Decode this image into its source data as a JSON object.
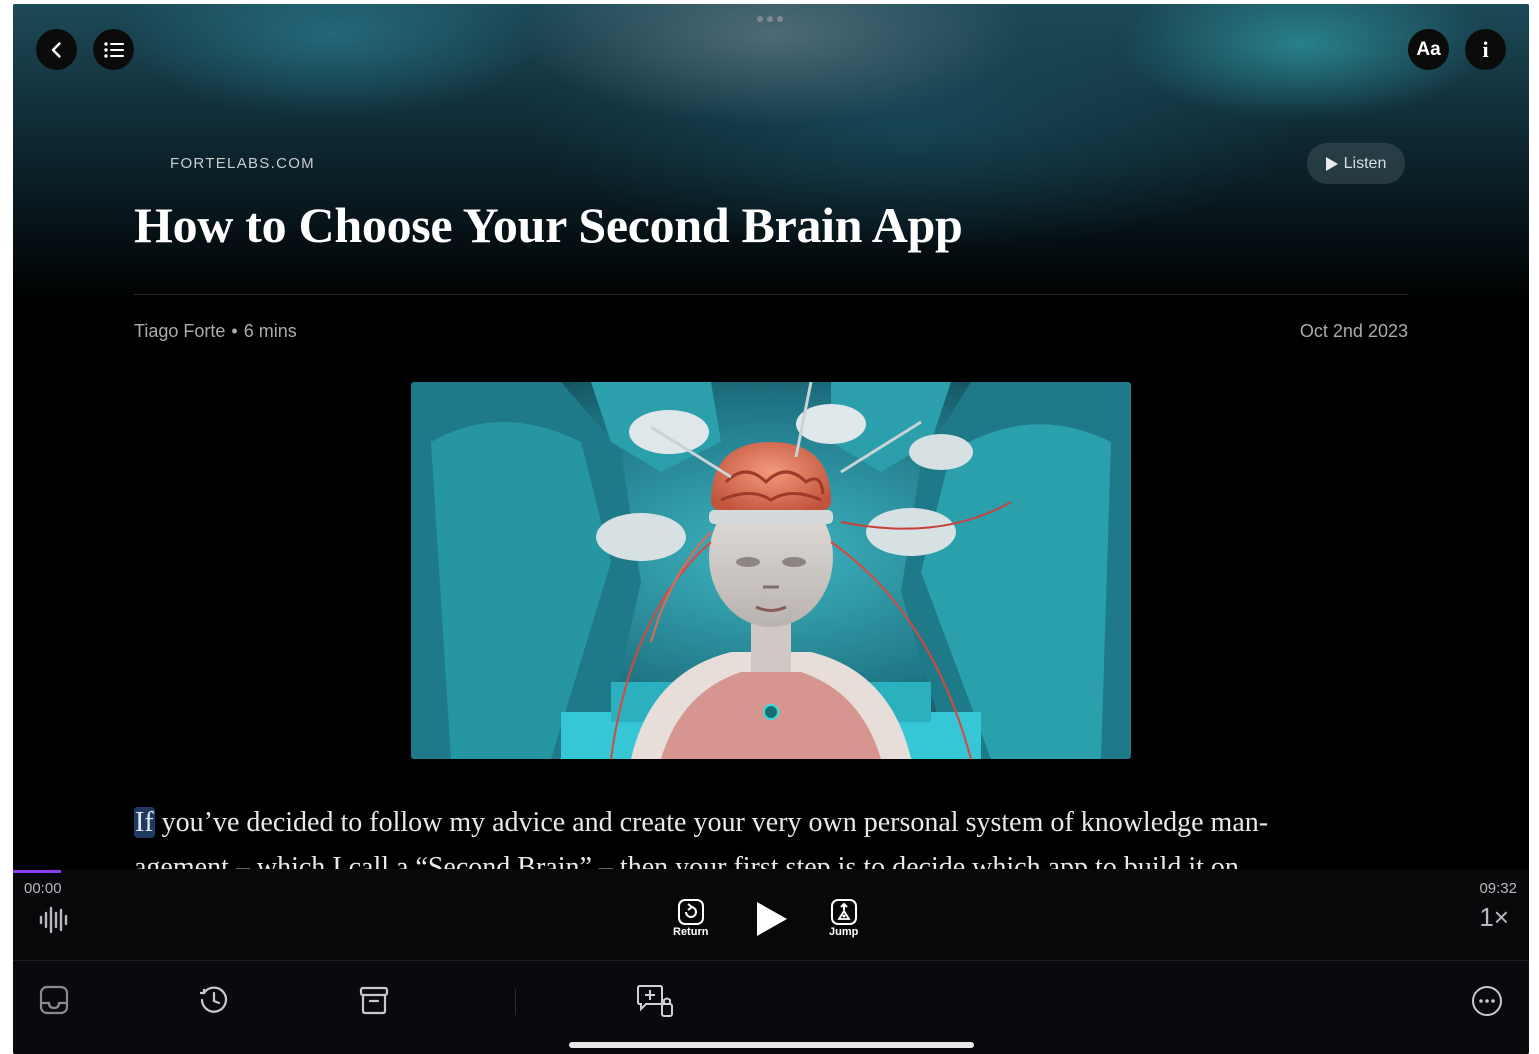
{
  "header": {
    "back_icon": "chevron-left-icon",
    "toc_icon": "list-icon",
    "font_button_label": "Aa",
    "info_button_label": "i",
    "more_handle_icon": "ellipsis-handle-icon"
  },
  "article": {
    "source": "FORTELABS.COM",
    "title": "How to Choose Your Second Brain App",
    "author": "Tiago Forte",
    "separator": "•",
    "read_time": "6 mins",
    "date": "Oct 2nd 2023",
    "listen_label": "Listen",
    "image_description_icon": "article-hero-image",
    "body_first_word": "If",
    "body_line1_rest": " you’ve decided to follow my advice and create your very own personal system of knowledge man-",
    "body_line2": "agement – which I call a “Second Brain” – then your first step is to decide which app to build it on"
  },
  "player": {
    "elapsed": "00:00",
    "duration": "09:32",
    "progress_fraction": 0.0,
    "return_label": "Return",
    "jump_label": "Jump",
    "speed": "1×"
  },
  "toolbar": {
    "items": [
      "inbox-icon",
      "clock-icon",
      "archive-icon",
      "add-note-icon",
      "more-icon"
    ]
  },
  "colors": {
    "accent": "#8a3df0",
    "background": "#000000",
    "highlight": "#1f3a63"
  }
}
